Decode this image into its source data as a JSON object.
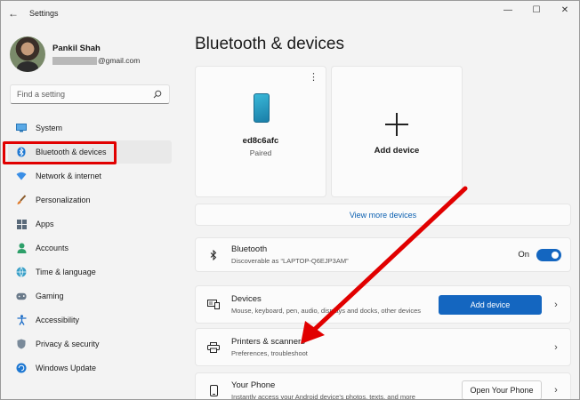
{
  "window": {
    "app_title": "Settings",
    "back_glyph": "←",
    "minimize_glyph": "—",
    "maximize_glyph": "☐",
    "close_glyph": "✕"
  },
  "profile": {
    "name": "Pankil Shah",
    "email_suffix": "@gmail.com"
  },
  "search": {
    "placeholder": "Find a setting",
    "icon": "search-icon"
  },
  "sidebar": {
    "items": [
      {
        "label": "System",
        "icon": "monitor-icon"
      },
      {
        "label": "Bluetooth & devices",
        "icon": "bluetooth-icon",
        "selected": true
      },
      {
        "label": "Network & internet",
        "icon": "wifi-icon"
      },
      {
        "label": "Personalization",
        "icon": "brush-icon"
      },
      {
        "label": "Apps",
        "icon": "apps-icon"
      },
      {
        "label": "Accounts",
        "icon": "person-icon"
      },
      {
        "label": "Time & language",
        "icon": "globe-icon"
      },
      {
        "label": "Gaming",
        "icon": "gamepad-icon"
      },
      {
        "label": "Accessibility",
        "icon": "accessibility-icon"
      },
      {
        "label": "Privacy & security",
        "icon": "shield-icon"
      },
      {
        "label": "Windows Update",
        "icon": "update-icon"
      }
    ]
  },
  "main": {
    "title": "Bluetooth & devices",
    "device_card": {
      "name": "ed8c6afc",
      "status": "Paired"
    },
    "add_card": {
      "label": "Add device"
    },
    "view_more": "View more devices",
    "bluetooth_row": {
      "title": "Bluetooth",
      "subtitle": "Discoverable as “LAPTOP-Q6EJP3AM”",
      "toggle_label": "On",
      "toggle_on": true
    },
    "devices_row": {
      "title": "Devices",
      "subtitle": "Mouse, keyboard, pen, audio, displays and docks, other devices",
      "button": "Add device"
    },
    "printers_row": {
      "title": "Printers & scanners",
      "subtitle": "Preferences, troubleshoot"
    },
    "phone_row": {
      "title": "Your Phone",
      "subtitle": "Instantly access your Android device's photos, texts, and more",
      "button": "Open Your Phone"
    }
  },
  "annotations": {
    "highlight_color": "#e10000",
    "arrow_color": "#e10000"
  },
  "colors": {
    "accent": "#1466c0",
    "link": "#0a5fb0",
    "background": "#f3f3f3",
    "card": "#fbfbfb"
  }
}
